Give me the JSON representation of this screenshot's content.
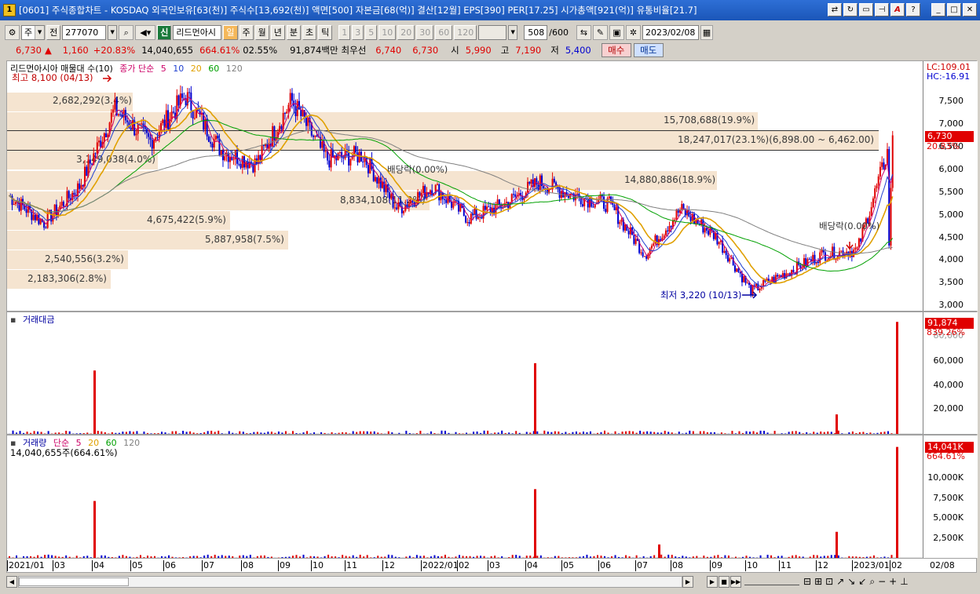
{
  "window": {
    "title": "[0601] 주식종합차트 - KOSDAQ 외국인보유[63(천)] 주식수[13,692(천)] 액면[500] 자본금[68(억)] 결산[12월] EPS[390] PER[17.25] 시가총액[921(억)] 유통비율[21.7]",
    "icon_text": "1"
  },
  "toolbar": {
    "period_select": "주",
    "prev_label": "전",
    "code": "277070",
    "new_badge": "신",
    "stock_name": "리드먼아시",
    "active_period": "일",
    "periods": [
      "주",
      "월",
      "년",
      "분",
      "초",
      "틱"
    ],
    "minute_units": [
      "1",
      "3",
      "5",
      "10",
      "20",
      "30",
      "60",
      "120"
    ],
    "count": "508",
    "count_total": "/600",
    "date": "2023/02/08"
  },
  "quote": {
    "price": "6,730",
    "change_arrow": "▲",
    "change": "1,160",
    "change_pct": "+20.83%",
    "volume": "14,040,655",
    "volume_pct": "664.61%",
    "turnover": "02.55%",
    "amount": "91,874백만",
    "bid_label": "최우선",
    "bid1": "6,740",
    "bid2": "6,730",
    "open_label": "시",
    "open": "5,990",
    "high_label": "고",
    "high": "7,190",
    "low_label": "저",
    "low": "5,400",
    "buy_label": "매수",
    "sell_label": "매도"
  },
  "price_panel": {
    "legend_vbp": "리드먼아시아 매물대 수(10)",
    "legend_ma_label": "종가 단순",
    "legend_ma": [
      "5",
      "10",
      "20",
      "60",
      "120"
    ],
    "high_annot": "최고 8,100 (04/13)",
    "low_annot": "최저 3,220 (10/13)",
    "dividend1": "배당락(0.00%)",
    "dividend2": "배당락(0.00%)",
    "lc": "LC:109.01",
    "hc": "HC:-16.91",
    "price_badge": "6,730",
    "price_badge_pct": "20.83%",
    "axis": [
      "7,500",
      "7,000",
      "6,500",
      "6,000",
      "5,500",
      "5,000",
      "4,500",
      "4,000",
      "3,500",
      "3,000"
    ],
    "vbp_labels": [
      "15,708,688(19.9%)",
      "18,247,017(23.1%)(6,898.00 ~ 6,462.00)",
      "14,880,886(18.9%)",
      "8,834,108(11.2%)",
      "2,682,292(3.4%)",
      "3,149,038(4.0%)",
      "4,675,422(5.9%)",
      "5,887,958(7.5%)",
      "2,540,556(3.2%)",
      "2,183,306(2.8%)"
    ]
  },
  "amount_panel": {
    "legend": "거래대금",
    "badge": "91,874",
    "badge_pct": "839.26%",
    "axis": [
      "80,000",
      "60,000",
      "40,000",
      "20,000"
    ]
  },
  "volume_panel": {
    "legend_label": "거래량",
    "legend_ma_label": "단순",
    "legend_ma": [
      "5",
      "20",
      "60",
      "120"
    ],
    "sub": "14,040,655주(664.61%)",
    "badge": "14,041K",
    "badge_pct": "664.61%",
    "axis": [
      "10,000K",
      "7,500K",
      "5,000K",
      "2,500K"
    ]
  },
  "date_axis": [
    "2021/01",
    "03",
    "04",
    "05",
    "06",
    "07",
    "08",
    "09",
    "10",
    "11",
    "12",
    "2022/01",
    "02",
    "03",
    "04",
    "05",
    "06",
    "07",
    "08",
    "09",
    "10",
    "11",
    "12",
    "2023/01",
    "02",
    "02/08"
  ],
  "colors": {
    "up": "#e00000",
    "down": "#0000d0",
    "ma5": "#cc0066",
    "ma10": "#2040d0",
    "ma20": "#e0a000",
    "ma60": "#00a000",
    "ma120": "#808080",
    "vbp": "#f5e4d0"
  },
  "chart_data": {
    "type": "candlestick",
    "title": "리드먼아시아 매물대 수(10)",
    "ylim": [
      3000,
      8100
    ],
    "price_points": [
      [
        "2021/01",
        5400
      ],
      [
        "2021/02",
        4800
      ],
      [
        "2021/03",
        5600
      ],
      [
        "2021/04",
        7300
      ],
      [
        "2021/05",
        6600
      ],
      [
        "2021/06",
        7600
      ],
      [
        "2021/07",
        6400
      ],
      [
        "2021/08",
        6100
      ],
      [
        "2021/09",
        7500
      ],
      [
        "2021/10",
        6200
      ],
      [
        "2021/11",
        6300
      ],
      [
        "2021/12",
        5100
      ],
      [
        "2022/01",
        5600
      ],
      [
        "2022/02",
        4900
      ],
      [
        "2022/03",
        5200
      ],
      [
        "2022/04",
        5700
      ],
      [
        "2022/05",
        5400
      ],
      [
        "2022/06",
        5200
      ],
      [
        "2022/07",
        4100
      ],
      [
        "2022/08",
        5100
      ],
      [
        "2022/09",
        4500
      ],
      [
        "2022/10",
        3300
      ],
      [
        "2022/11",
        3700
      ],
      [
        "2022/12",
        4100
      ],
      [
        "2023/01",
        4200
      ],
      [
        "2023/02",
        6730
      ]
    ],
    "volume_by_price": [
      {
        "range": "7,500~8,100",
        "volume": 2682292,
        "pct": 3.4
      },
      {
        "range": "6,898~7,400",
        "volume": 15708688,
        "pct": 19.9
      },
      {
        "range": "6,462~6,898",
        "volume": 18247017,
        "pct": 23.1
      },
      {
        "range": "5,980~6,462",
        "volume": 3149038,
        "pct": 4.0
      },
      {
        "range": "5,500~5,980",
        "volume": 14880886,
        "pct": 18.9
      },
      {
        "range": "5,020~5,500",
        "volume": 8834108,
        "pct": 11.2
      },
      {
        "range": "4,540~5,020",
        "volume": 4675422,
        "pct": 5.9
      },
      {
        "range": "4,060~4,540",
        "volume": 5887958,
        "pct": 7.5
      },
      {
        "range": "3,580~4,060",
        "volume": 2540556,
        "pct": 3.2
      },
      {
        "range": "3,220~3,580",
        "volume": 2183306,
        "pct": 2.8
      }
    ],
    "amount_spikes": [
      {
        "date": "2021/04",
        "value": 52000
      },
      {
        "date": "2022/04",
        "value": 58000
      },
      {
        "date": "2022/12",
        "value": 16000
      },
      {
        "date": "2023/02/08",
        "value": 91874
      }
    ],
    "volume_spikes": [
      {
        "date": "2021/04",
        "value": 7200
      },
      {
        "date": "2022/04",
        "value": 8700
      },
      {
        "date": "2022/07",
        "value": 1700
      },
      {
        "date": "2022/12",
        "value": 3300
      },
      {
        "date": "2023/02/08",
        "value": 14041
      }
    ]
  }
}
